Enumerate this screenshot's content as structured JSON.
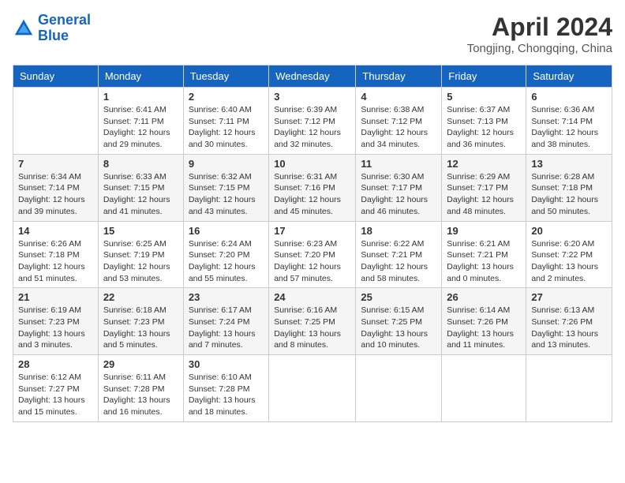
{
  "header": {
    "logo_line1": "General",
    "logo_line2": "Blue",
    "month_title": "April 2024",
    "location": "Tongjing, Chongqing, China"
  },
  "weekdays": [
    "Sunday",
    "Monday",
    "Tuesday",
    "Wednesday",
    "Thursday",
    "Friday",
    "Saturday"
  ],
  "weeks": [
    [
      {
        "day": "",
        "info": ""
      },
      {
        "day": "1",
        "info": "Sunrise: 6:41 AM\nSunset: 7:11 PM\nDaylight: 12 hours\nand 29 minutes."
      },
      {
        "day": "2",
        "info": "Sunrise: 6:40 AM\nSunset: 7:11 PM\nDaylight: 12 hours\nand 30 minutes."
      },
      {
        "day": "3",
        "info": "Sunrise: 6:39 AM\nSunset: 7:12 PM\nDaylight: 12 hours\nand 32 minutes."
      },
      {
        "day": "4",
        "info": "Sunrise: 6:38 AM\nSunset: 7:12 PM\nDaylight: 12 hours\nand 34 minutes."
      },
      {
        "day": "5",
        "info": "Sunrise: 6:37 AM\nSunset: 7:13 PM\nDaylight: 12 hours\nand 36 minutes."
      },
      {
        "day": "6",
        "info": "Sunrise: 6:36 AM\nSunset: 7:14 PM\nDaylight: 12 hours\nand 38 minutes."
      }
    ],
    [
      {
        "day": "7",
        "info": "Sunrise: 6:34 AM\nSunset: 7:14 PM\nDaylight: 12 hours\nand 39 minutes."
      },
      {
        "day": "8",
        "info": "Sunrise: 6:33 AM\nSunset: 7:15 PM\nDaylight: 12 hours\nand 41 minutes."
      },
      {
        "day": "9",
        "info": "Sunrise: 6:32 AM\nSunset: 7:15 PM\nDaylight: 12 hours\nand 43 minutes."
      },
      {
        "day": "10",
        "info": "Sunrise: 6:31 AM\nSunset: 7:16 PM\nDaylight: 12 hours\nand 45 minutes."
      },
      {
        "day": "11",
        "info": "Sunrise: 6:30 AM\nSunset: 7:17 PM\nDaylight: 12 hours\nand 46 minutes."
      },
      {
        "day": "12",
        "info": "Sunrise: 6:29 AM\nSunset: 7:17 PM\nDaylight: 12 hours\nand 48 minutes."
      },
      {
        "day": "13",
        "info": "Sunrise: 6:28 AM\nSunset: 7:18 PM\nDaylight: 12 hours\nand 50 minutes."
      }
    ],
    [
      {
        "day": "14",
        "info": "Sunrise: 6:26 AM\nSunset: 7:18 PM\nDaylight: 12 hours\nand 51 minutes."
      },
      {
        "day": "15",
        "info": "Sunrise: 6:25 AM\nSunset: 7:19 PM\nDaylight: 12 hours\nand 53 minutes."
      },
      {
        "day": "16",
        "info": "Sunrise: 6:24 AM\nSunset: 7:20 PM\nDaylight: 12 hours\nand 55 minutes."
      },
      {
        "day": "17",
        "info": "Sunrise: 6:23 AM\nSunset: 7:20 PM\nDaylight: 12 hours\nand 57 minutes."
      },
      {
        "day": "18",
        "info": "Sunrise: 6:22 AM\nSunset: 7:21 PM\nDaylight: 12 hours\nand 58 minutes."
      },
      {
        "day": "19",
        "info": "Sunrise: 6:21 AM\nSunset: 7:21 PM\nDaylight: 13 hours\nand 0 minutes."
      },
      {
        "day": "20",
        "info": "Sunrise: 6:20 AM\nSunset: 7:22 PM\nDaylight: 13 hours\nand 2 minutes."
      }
    ],
    [
      {
        "day": "21",
        "info": "Sunrise: 6:19 AM\nSunset: 7:23 PM\nDaylight: 13 hours\nand 3 minutes."
      },
      {
        "day": "22",
        "info": "Sunrise: 6:18 AM\nSunset: 7:23 PM\nDaylight: 13 hours\nand 5 minutes."
      },
      {
        "day": "23",
        "info": "Sunrise: 6:17 AM\nSunset: 7:24 PM\nDaylight: 13 hours\nand 7 minutes."
      },
      {
        "day": "24",
        "info": "Sunrise: 6:16 AM\nSunset: 7:25 PM\nDaylight: 13 hours\nand 8 minutes."
      },
      {
        "day": "25",
        "info": "Sunrise: 6:15 AM\nSunset: 7:25 PM\nDaylight: 13 hours\nand 10 minutes."
      },
      {
        "day": "26",
        "info": "Sunrise: 6:14 AM\nSunset: 7:26 PM\nDaylight: 13 hours\nand 11 minutes."
      },
      {
        "day": "27",
        "info": "Sunrise: 6:13 AM\nSunset: 7:26 PM\nDaylight: 13 hours\nand 13 minutes."
      }
    ],
    [
      {
        "day": "28",
        "info": "Sunrise: 6:12 AM\nSunset: 7:27 PM\nDaylight: 13 hours\nand 15 minutes."
      },
      {
        "day": "29",
        "info": "Sunrise: 6:11 AM\nSunset: 7:28 PM\nDaylight: 13 hours\nand 16 minutes."
      },
      {
        "day": "30",
        "info": "Sunrise: 6:10 AM\nSunset: 7:28 PM\nDaylight: 13 hours\nand 18 minutes."
      },
      {
        "day": "",
        "info": ""
      },
      {
        "day": "",
        "info": ""
      },
      {
        "day": "",
        "info": ""
      },
      {
        "day": "",
        "info": ""
      }
    ]
  ]
}
